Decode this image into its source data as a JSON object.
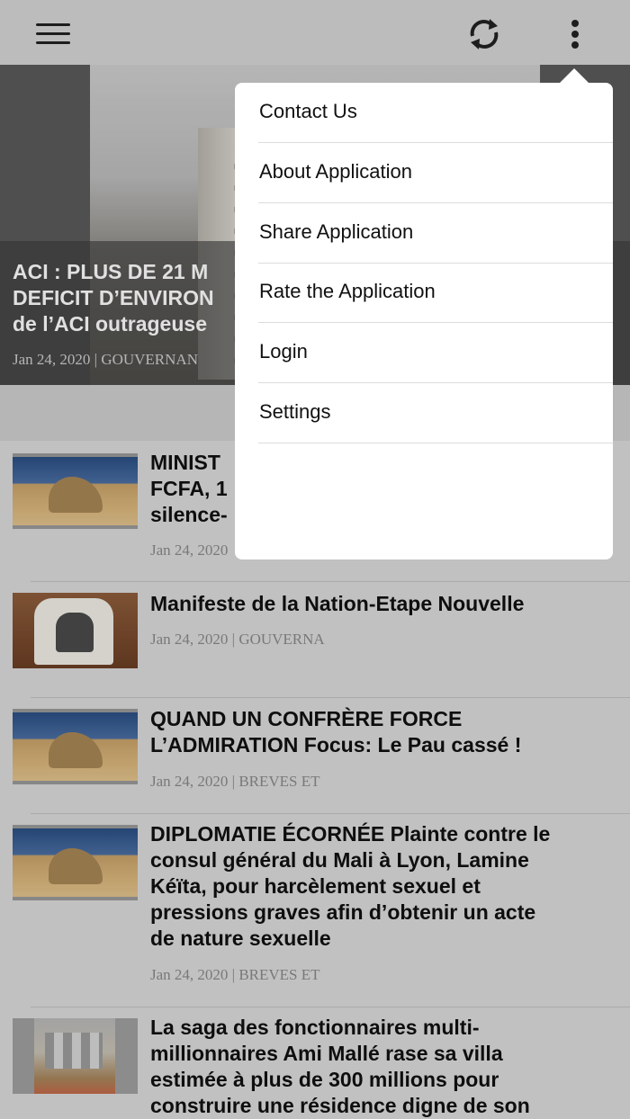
{
  "toolbar": {
    "menu_icon": "hamburger-menu-icon",
    "refresh_icon": "refresh-icon",
    "overflow_icon": "more-vertical-icon"
  },
  "hero": {
    "title": "ACI : PLUS DE 21 M… DEFICIT D’ENVIRON… de l’ACI outrageuse…",
    "title_lines": [
      "ACI : PLUS DE 21 M",
      "DEFICIT D’ENVIRON",
      "de l’ACI outrageuse"
    ],
    "meta": "Jan 24, 2020 | GOUVERNAN"
  },
  "articles": [
    {
      "title_lines": [
        "MINIST",
        "FCFA, 1",
        "silence-"
      ],
      "meta": "Jan 24, 2020",
      "thumb": "sphinx"
    },
    {
      "title_lines": [
        "Manifeste de la Nation-Etape Nouvelle"
      ],
      "meta": "Jan 24, 2020 | GOUVERNA",
      "thumb": "chair"
    },
    {
      "title_lines": [
        "QUAND UN CONFRÈRE FORCE",
        "L’ADMIRATION Focus: Le Pau cassé !"
      ],
      "meta": "Jan 24, 2020 | BREVES ET",
      "thumb": "sphinx"
    },
    {
      "title_lines": [
        "DIPLOMATIE ÉCORNÉE Plainte contre le",
        "consul général du Mali à Lyon, Lamine",
        "Kéïta, pour harcèlement sexuel et",
        "pressions graves afin d’obtenir un acte",
        "de nature sexuelle"
      ],
      "meta": "Jan 24, 2020 | BREVES ET",
      "thumb": "sphinx"
    },
    {
      "title_lines": [
        "La saga des fonctionnaires multi-",
        "millionnaires Ami Mallé rase sa villa",
        "estimée à plus de 300 millions pour",
        "construire une résidence digne de son"
      ],
      "meta": "",
      "thumb": "house"
    }
  ],
  "menu": {
    "items": [
      "Contact Us",
      "About Application",
      "Share Application",
      "Rate the Application",
      "Login",
      "Settings"
    ]
  }
}
